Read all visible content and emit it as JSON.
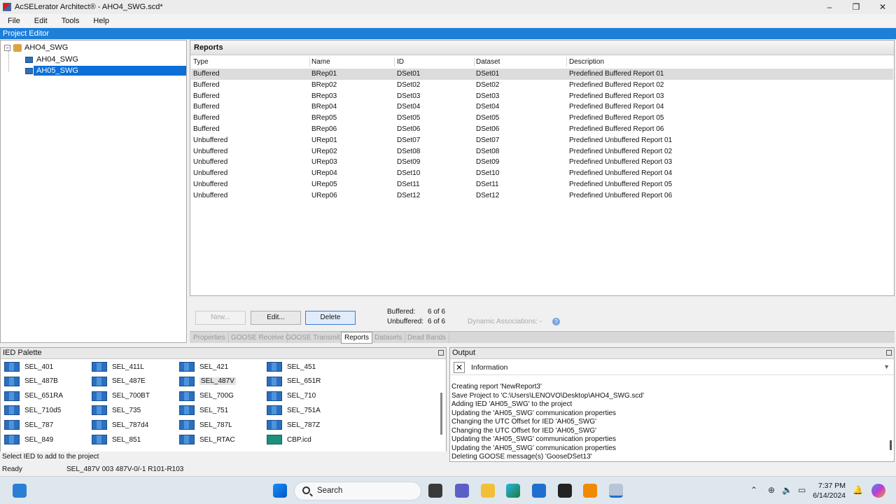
{
  "window": {
    "title": "AcSELerator Architect® - AHO4_SWG.scd*",
    "controls": {
      "minimize": "–",
      "restore": "❐",
      "close": "✕"
    }
  },
  "menu": [
    "File",
    "Edit",
    "Tools",
    "Help"
  ],
  "project_editor": {
    "label": "Project Editor"
  },
  "tree": {
    "root": "AHO4_SWG",
    "children": [
      "AH04_SWG",
      "AH05_SWG"
    ],
    "selected": "AH05_SWG"
  },
  "reports": {
    "title": "Reports",
    "columns": [
      "Type",
      "Name",
      "ID",
      "Dataset",
      "Description"
    ],
    "rows": [
      {
        "type": "Buffered",
        "name": "BRep01",
        "id": "DSet01",
        "dataset": "DSet01",
        "description": "Predefined Buffered Report 01"
      },
      {
        "type": "Buffered",
        "name": "BRep02",
        "id": "DSet02",
        "dataset": "DSet02",
        "description": "Predefined Buffered Report 02"
      },
      {
        "type": "Buffered",
        "name": "BRep03",
        "id": "DSet03",
        "dataset": "DSet03",
        "description": "Predefined Buffered Report 03"
      },
      {
        "type": "Buffered",
        "name": "BRep04",
        "id": "DSet04",
        "dataset": "DSet04",
        "description": "Predefined Buffered Report 04"
      },
      {
        "type": "Buffered",
        "name": "BRep05",
        "id": "DSet05",
        "dataset": "DSet05",
        "description": "Predefined Buffered Report 05"
      },
      {
        "type": "Buffered",
        "name": "BRep06",
        "id": "DSet06",
        "dataset": "DSet06",
        "description": "Predefined Buffered Report 06"
      },
      {
        "type": "Unbuffered",
        "name": "URep01",
        "id": "DSet07",
        "dataset": "DSet07",
        "description": "Predefined Unbuffered Report 01"
      },
      {
        "type": "Unbuffered",
        "name": "URep02",
        "id": "DSet08",
        "dataset": "DSet08",
        "description": "Predefined Unbuffered Report 02"
      },
      {
        "type": "Unbuffered",
        "name": "URep03",
        "id": "DSet09",
        "dataset": "DSet09",
        "description": "Predefined Unbuffered Report 03"
      },
      {
        "type": "Unbuffered",
        "name": "URep04",
        "id": "DSet10",
        "dataset": "DSet10",
        "description": "Predefined Unbuffered Report 04"
      },
      {
        "type": "Unbuffered",
        "name": "URep05",
        "id": "DSet11",
        "dataset": "DSet11",
        "description": "Predefined Unbuffered Report 05"
      },
      {
        "type": "Unbuffered",
        "name": "URep06",
        "id": "DSet12",
        "dataset": "DSet12",
        "description": "Predefined Unbuffered Report 06"
      }
    ],
    "buttons": {
      "new": "New...",
      "edit": "Edit...",
      "delete": "Delete"
    },
    "counts": {
      "buffered_label": "Buffered:",
      "buffered_value": "6 of 6",
      "unbuffered_label": "Unbuffered:",
      "unbuffered_value": "6 of 6"
    },
    "dynamic_associations": "Dynamic Associations:  -",
    "help": "?",
    "tabs": [
      "Properties",
      "GOOSE Receive",
      "GOOSE Transmit",
      "Reports",
      "Datasets",
      "Dead Bands"
    ],
    "active_tab": "Reports"
  },
  "ied_palette": {
    "title": "IED Palette",
    "items": [
      "SEL_401",
      "SEL_411L",
      "SEL_421",
      "SEL_451",
      "SEL_487B",
      "SEL_487E",
      "SEL_487V",
      "SEL_651R",
      "SEL_651RA",
      "SEL_700BT",
      "SEL_700G",
      "SEL_710",
      "SEL_710d5",
      "SEL_735",
      "SEL_751",
      "SEL_751A",
      "SEL_787",
      "SEL_787d4",
      "SEL_787L",
      "SEL_787Z",
      "SEL_849",
      "SEL_851",
      "SEL_RTAC",
      "CBP.icd"
    ],
    "highlighted": "SEL_487V",
    "status": "Select  IED to add to the project"
  },
  "output": {
    "title": "Output",
    "filter": "Information",
    "log": [
      "Creating report 'NewReport3'",
      "Save Project to 'C:\\Users\\LENOVO\\Desktop\\AHO4_SWG.scd'",
      "Adding IED 'AH05_SWG' to the project",
      "Updating the 'AH05_SWG' communication properties",
      "Changing the UTC Offset for IED 'AH05_SWG'",
      "Changing the UTC Offset for IED 'AH05_SWG'",
      "Updating the 'AH05_SWG' communication properties",
      "Updating the 'AH05_SWG' communication properties",
      "Deleting GOOSE message(s) 'GooseDSet13'"
    ]
  },
  "statusbar": {
    "state": "Ready",
    "info": "SEL_487V  003  487V-0/-1 R101-R103"
  },
  "taskbar": {
    "search_placeholder": "Search",
    "time": "7:37 PM",
    "date": "6/14/2024",
    "colors": {
      "accent": "#1e7fd9",
      "selection": "#0b6fd6"
    }
  }
}
